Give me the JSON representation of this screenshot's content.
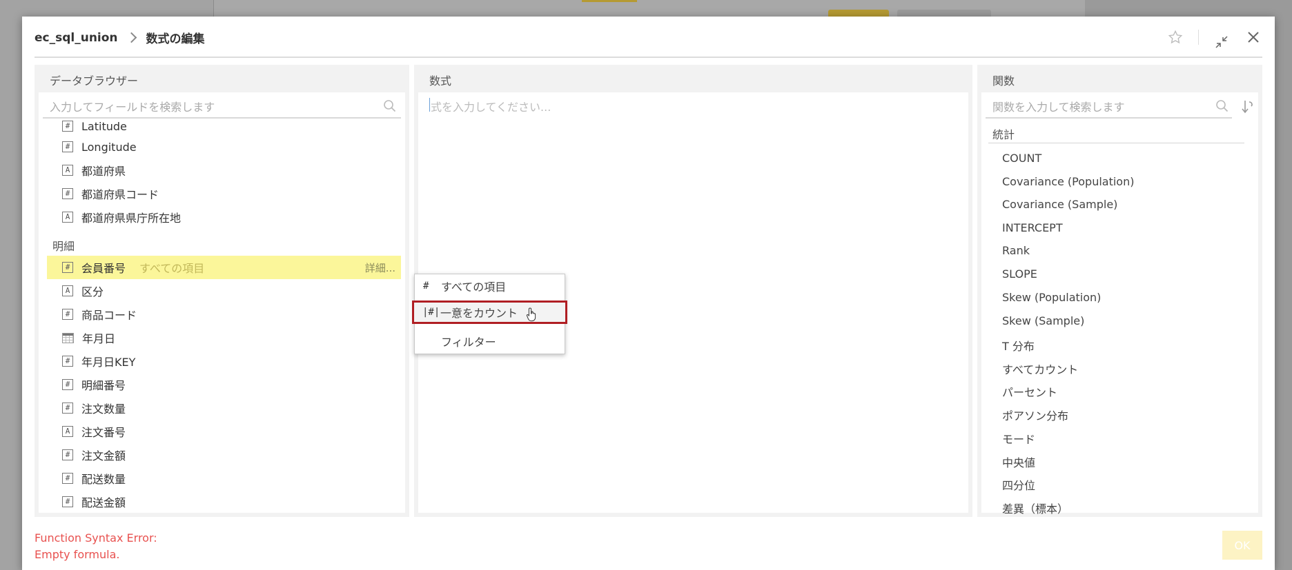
{
  "header": {
    "breadcrumb_root": "ec_sql_union",
    "breadcrumb_current": "数式の編集"
  },
  "browser": {
    "title": "データブラウザー",
    "search_placeholder": "入力してフィールドを検索します",
    "partial_item": "Latitude",
    "items_top": [
      {
        "icon": "#",
        "label": "Longitude"
      },
      {
        "icon": "A",
        "label": "都道府県"
      },
      {
        "icon": "#",
        "label": "都道府県コード"
      },
      {
        "icon": "A",
        "label": "都道府県県庁所在地"
      }
    ],
    "group_label": "明細",
    "selected_item": {
      "icon": "#",
      "label": "会員番号",
      "sub": "すべての項目",
      "detail": "詳細..."
    },
    "items_bottom": [
      {
        "icon": "A",
        "label": "区分"
      },
      {
        "icon": "#",
        "label": "商品コード"
      },
      {
        "icon": "date",
        "label": "年月日"
      },
      {
        "icon": "#",
        "label": "年月日KEY"
      },
      {
        "icon": "#",
        "label": "明細番号"
      },
      {
        "icon": "#",
        "label": "注文数量"
      },
      {
        "icon": "A",
        "label": "注文番号"
      },
      {
        "icon": "#",
        "label": "注文金額"
      },
      {
        "icon": "#",
        "label": "配送数量"
      },
      {
        "icon": "#",
        "label": "配送金額"
      }
    ]
  },
  "popup": {
    "items": [
      {
        "icon": "#",
        "label": "すべての項目"
      },
      {
        "icon": "|#|",
        "label": "一意をカウント"
      },
      {
        "icon": "",
        "label": "フィルター"
      }
    ]
  },
  "formula": {
    "title": "数式",
    "placeholder": "式を入力してください..."
  },
  "functions": {
    "title": "関数",
    "search_placeholder": "関数を入力して検索します",
    "category": "統計",
    "items": [
      "COUNT",
      "Covariance (Population)",
      "Covariance (Sample)",
      "INTERCEPT",
      "Rank",
      "SLOPE",
      "Skew (Population)",
      "Skew (Sample)",
      "T 分布",
      "すべてカウント",
      "パーセント",
      "ポアソン分布",
      "モード",
      "中央値",
      "四分位",
      "差異（標本）"
    ]
  },
  "footer": {
    "error_line1": "Function Syntax Error:",
    "error_line2": "Empty formula.",
    "ok_label": "OK"
  },
  "colors": {
    "selected_row": "#fbf69a",
    "error": "#e8514f",
    "highlight_border": "#b01e23"
  }
}
